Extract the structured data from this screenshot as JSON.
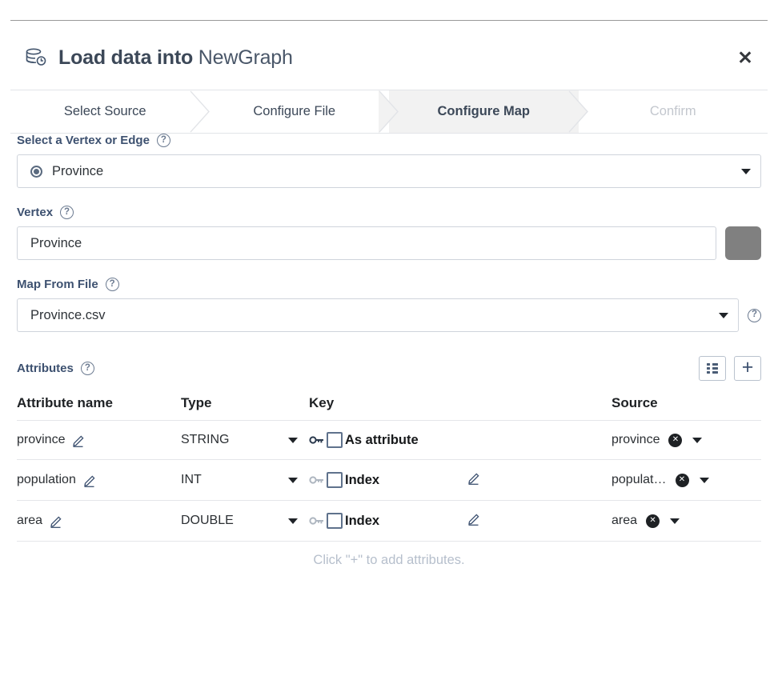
{
  "header": {
    "icon": "database-icon",
    "title_strong": "Load data into",
    "title_light": "NewGraph",
    "close_label": "✕"
  },
  "stepper": {
    "steps": [
      {
        "label": "Select Source",
        "state": "done"
      },
      {
        "label": "Configure File",
        "state": "done"
      },
      {
        "label": "Configure Map",
        "state": "active"
      },
      {
        "label": "Confirm",
        "state": "disabled"
      }
    ]
  },
  "fields": {
    "select_vertex_or_edge": {
      "label": "Select a Vertex or Edge",
      "help": "?",
      "value": "Province"
    },
    "vertex": {
      "label": "Vertex",
      "help": "?",
      "value": "Province",
      "color": "#808080"
    },
    "map_from_file": {
      "label": "Map From File",
      "help": "?",
      "value": "Province.csv",
      "trailing_help": "?"
    }
  },
  "attributes": {
    "label": "Attributes",
    "help": "?",
    "view_button": "grid-view-icon",
    "add_button": "+",
    "columns": [
      "Attribute name",
      "Type",
      "Key",
      "",
      "Source"
    ],
    "rows": [
      {
        "name": "province",
        "type": "STRING",
        "key_label": "As attribute",
        "key_checked": false,
        "key_enabled": true,
        "has_key_edit": false,
        "source": "province"
      },
      {
        "name": "population",
        "type": "INT",
        "key_label": "Index",
        "key_checked": false,
        "key_enabled": false,
        "has_key_edit": true,
        "source": "populat…"
      },
      {
        "name": "area",
        "type": "DOUBLE",
        "key_label": "Index",
        "key_checked": false,
        "key_enabled": false,
        "has_key_edit": true,
        "source": "area"
      }
    ],
    "hint": "Click \"+\" to add attributes.",
    "clear_glyph": "✕"
  }
}
